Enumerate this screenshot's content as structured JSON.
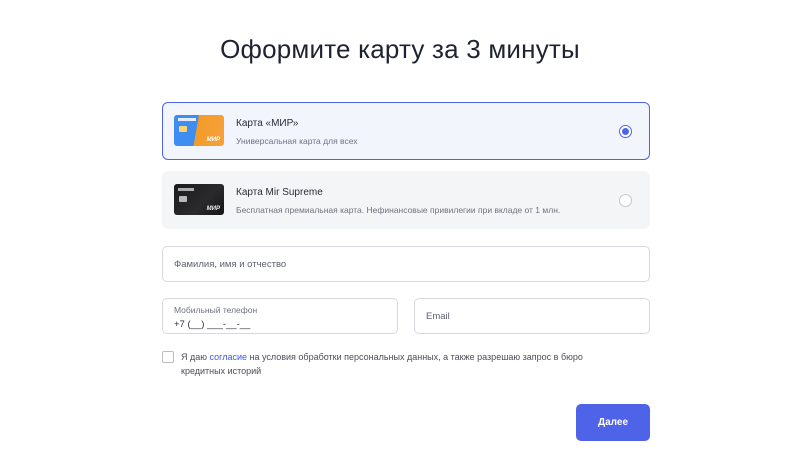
{
  "title": "Оформите карту за 3 минуты",
  "cards": [
    {
      "name": "Карта «МИР»",
      "description": "Универсальная карта для всех",
      "selected": true,
      "thumb_logo": "МИР"
    },
    {
      "name": "Карта Mir Supreme",
      "description": "Бесплатная премиальная карта. Нефинансовые привилегии при вкладе от 1 млн.",
      "selected": false,
      "thumb_logo": "МИР"
    }
  ],
  "form": {
    "fio_placeholder": "Фамилия, имя и отчество",
    "phone_label": "Мобильный телефон",
    "phone_value": "+7 (__) ___-__-__",
    "email_placeholder": "Email"
  },
  "consent": {
    "before": "Я даю ",
    "link": "согласие",
    "after": " на условия обработки персональных данных, а также разрешаю запрос в бюро",
    "line2": "кредитных историй",
    "checked": false
  },
  "submit_label": "Далее",
  "colors": {
    "accent": "#4f63e8",
    "selected_bg": "#f3f5fd",
    "option_bg": "#f4f5f7"
  }
}
